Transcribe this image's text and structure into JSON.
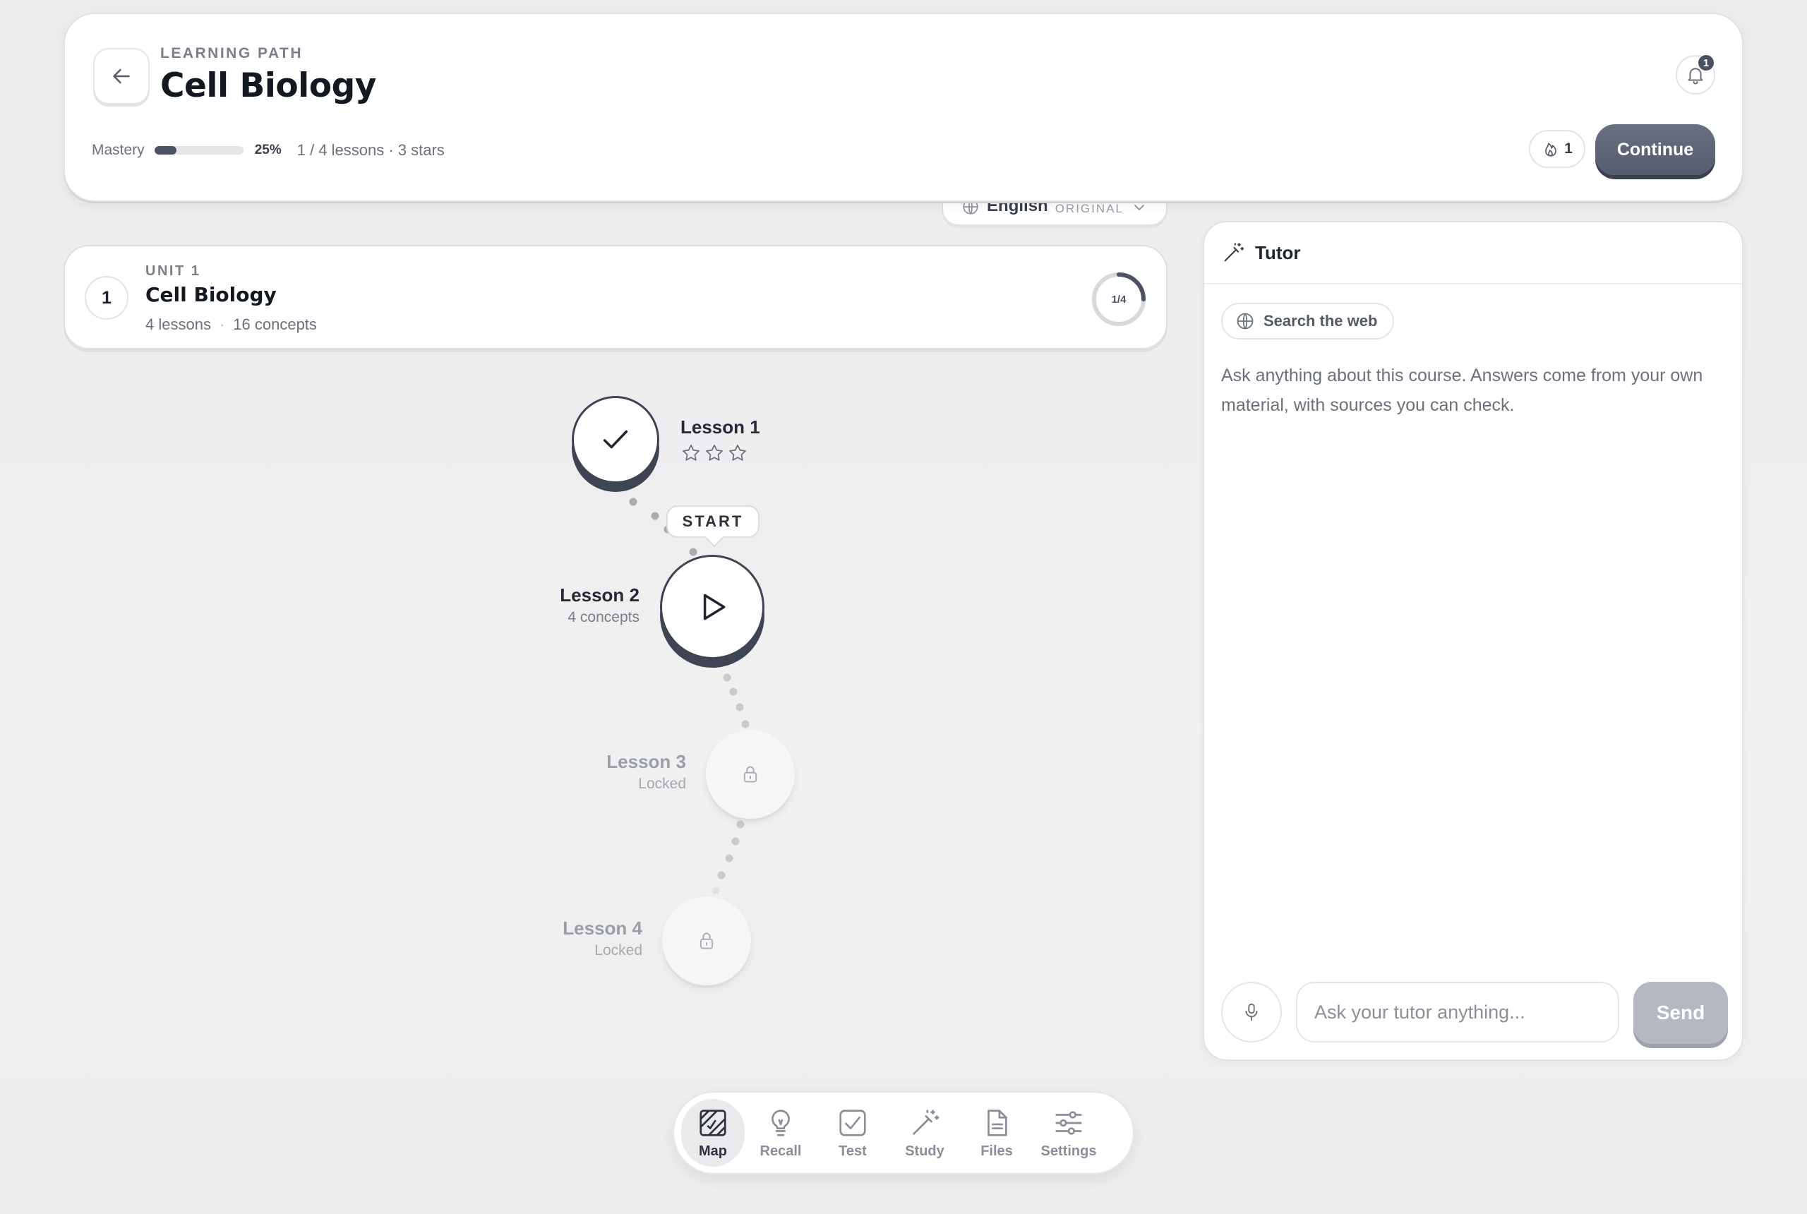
{
  "header": {
    "eyebrow": "LEARNING PATH",
    "title": "Cell Biology",
    "notification_count": "1",
    "mastery_label": "Mastery",
    "mastery_percent": "25%",
    "mastery_value": 0.25,
    "progress_meta": "1 / 4 lessons · 3 stars",
    "streak_count": "1",
    "continue_label": "Continue"
  },
  "language": {
    "name": "English",
    "tag": "ORIGINAL"
  },
  "unit": {
    "number": "1",
    "eyebrow": "UNIT 1",
    "title": "Cell Biology",
    "lessons": "4 lessons",
    "concepts": "16 concepts",
    "progress_label": "1/4",
    "progress_value": 0.25
  },
  "lessons": [
    {
      "name": "Lesson 1",
      "status": "completed",
      "stars_earned": 0,
      "stars_total": 3
    },
    {
      "name": "Lesson 2",
      "sub": "4 concepts",
      "status": "current",
      "badge": "START"
    },
    {
      "name": "Lesson 3",
      "sub": "Locked",
      "status": "locked"
    },
    {
      "name": "Lesson 4",
      "sub": "Locked",
      "status": "locked"
    }
  ],
  "tutor": {
    "title": "Tutor",
    "web_chip": "Search the web",
    "intro": "Ask anything about this course. Answers come from your own material, with sources you can check.",
    "input_placeholder": "Ask your tutor anything...",
    "send_label": "Send"
  },
  "nav": {
    "items": [
      {
        "label": "Map",
        "icon": "map-icon",
        "active": true
      },
      {
        "label": "Recall",
        "icon": "lightbulb-icon"
      },
      {
        "label": "Test",
        "icon": "checkbox-icon"
      },
      {
        "label": "Study",
        "icon": "magic-wand-icon"
      },
      {
        "label": "Files",
        "icon": "file-icon"
      },
      {
        "label": "Settings",
        "icon": "sliders-icon"
      }
    ]
  },
  "colors": {
    "accent": "#4a5061",
    "continue_button": "#606779",
    "send_disabled": "#b4b8c0",
    "background": "#eeeeef"
  }
}
